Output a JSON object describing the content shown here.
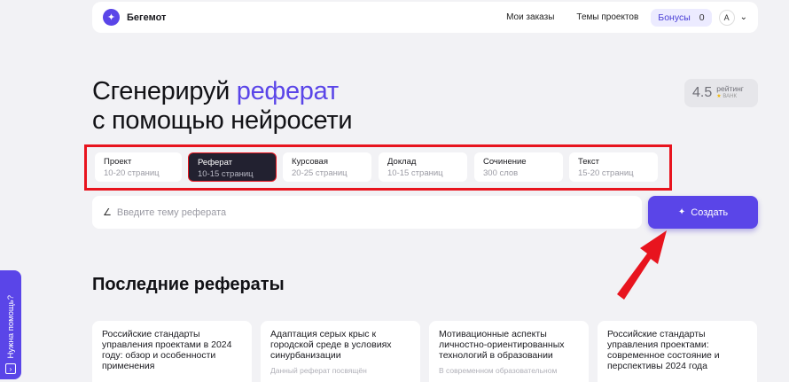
{
  "header": {
    "logo_glyph": "✦",
    "brand": "Бегемот",
    "nav": {
      "orders": "Мои заказы",
      "topics": "Темы проектов"
    },
    "bonus_label": "Бонусы",
    "bonus_count": "0",
    "avatar_letter": "A",
    "chevron": "⌄"
  },
  "hero": {
    "line1_prefix": "Сгенерируй ",
    "line1_accent": "реферат",
    "line2": "с помощью нейросети",
    "accent_color": "#5a45e8"
  },
  "rating": {
    "value": "4.5",
    "label": "рейтинг",
    "star": "★",
    "source": "ВАНК"
  },
  "types": [
    {
      "name": "Проект",
      "sub": "10-20 страниц"
    },
    {
      "name": "Реферат",
      "sub": "10-15 страниц"
    },
    {
      "name": "Курсовая",
      "sub": "20-25 страниц"
    },
    {
      "name": "Доклад",
      "sub": "10-15 страниц"
    },
    {
      "name": "Сочинение",
      "sub": "300 слов"
    },
    {
      "name": "Текст",
      "sub": "15-20 страниц"
    }
  ],
  "selected_type": "Реферат",
  "topic": {
    "icon": "pencil-icon",
    "placeholder": "Введите тему реферата",
    "value": ""
  },
  "create_button": {
    "icon": "sparkle-icon",
    "label": "Создать"
  },
  "recent": {
    "title": "Последние рефераты",
    "cards": [
      {
        "title": "Российские стандарты управления проектами в 2024 году: обзор и особенности применения",
        "snippet": ""
      },
      {
        "title": "Адаптация серых крыс к городской среде в условиях синурбанизации",
        "snippet": "Данный реферат посвящён"
      },
      {
        "title": "Мотивационные аспекты личностно-ориентированных технологий в образовании",
        "snippet": "В современном образовательном"
      },
      {
        "title": "Российские стандарты управления проектами: современное состояние и перспективы 2024 года",
        "snippet": ""
      }
    ]
  },
  "help": {
    "label": "Нужна помощь?",
    "icon": "chat-icon"
  },
  "highlight_color": "#e8141e"
}
